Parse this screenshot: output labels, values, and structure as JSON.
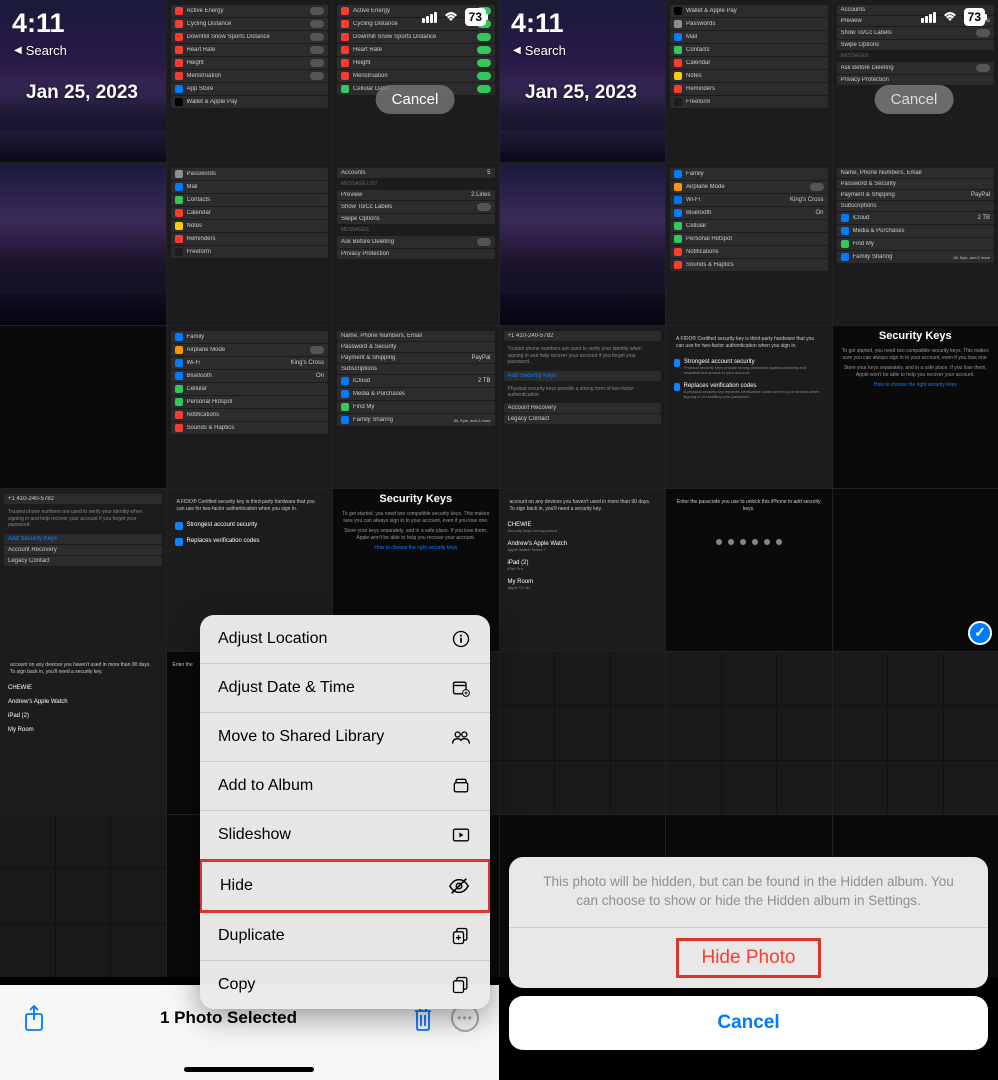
{
  "status": {
    "time": "4:11",
    "back": "Search",
    "battery": "73"
  },
  "date": "Jan 25, 2023",
  "cancel_pill": "Cancel",
  "context_menu": {
    "items": [
      {
        "label": "Adjust Location",
        "icon": "info-icon"
      },
      {
        "label": "Adjust Date & Time",
        "icon": "calendar-plus-icon"
      },
      {
        "label": "Move to Shared Library",
        "icon": "people-icon"
      },
      {
        "label": "Add to Album",
        "icon": "album-icon"
      },
      {
        "label": "Slideshow",
        "icon": "play-rect-icon"
      },
      {
        "label": "Hide",
        "icon": "eye-slash-icon",
        "highlighted": true
      },
      {
        "label": "Duplicate",
        "icon": "duplicate-icon"
      },
      {
        "label": "Copy",
        "icon": "copy-icon"
      }
    ]
  },
  "bottom_bar": {
    "selected": "1 Photo Selected"
  },
  "action_sheet": {
    "message": "This photo will be hidden, but can be found in the Hidden album. You can choose to show or hide the Hidden album in Settings.",
    "action": "Hide Photo",
    "cancel": "Cancel"
  },
  "tiles": {
    "security_keys_title": "Security Keys",
    "security_keys_text1": "To get started, you need two compatible security keys. This makes sure you can always sign in to your account, even if you lose one.",
    "security_keys_text2": "Store your keys separately, and in a safe place. If you lose them, Apple won't be able to help you recover your account.",
    "security_keys_link": "How to choose the right security keys",
    "passcode_prompt": "Enter the passcode you use to unlock this iPhone to add security keys.",
    "signin_prompt": "account on any devices you haven't used in more than 90 days. To sign back in, you'll need a security key.",
    "devices": [
      "CHEWIE",
      "Andrew's Apple Watch",
      "iPad (2)",
      "My Room"
    ],
    "health_rows": [
      "Active Energy",
      "Cycling Distance",
      "Downhill Snow Sports Distance",
      "Heart Rate",
      "Height",
      "Menstruation",
      "App Store",
      "Wallet & Apple Pay"
    ],
    "settings_rows": [
      "Passwords",
      "Mail",
      "Contacts",
      "Calendar",
      "Notes",
      "Reminders",
      "Freeform"
    ],
    "settings_rows2": [
      "Family",
      "Airplane Mode",
      "Wi-Fi",
      "Bluetooth",
      "Cellular",
      "Personal Hotspot",
      "Notifications",
      "Sounds & Haptics"
    ],
    "settings_rows3": [
      "Accounts",
      "Preview",
      "Show To/Cc Labels",
      "Swipe Options",
      "Ask Before Deleting",
      "Privacy Protection"
    ],
    "settings_rows4": [
      "Name, Phone Numbers, Email",
      "Password & Security",
      "Payment & Shipping",
      "Subscriptions",
      "iCloud",
      "Media & Purchases",
      "Find My",
      "Family Sharing"
    ],
    "phone_number": "+1 410-240-5782",
    "add_keys": "Add Security Keys",
    "account_recovery": "Account Recovery",
    "legacy_contact": "Legacy Contact",
    "strong_security": "Strongest account security",
    "replaces_codes": "Replaces verification codes",
    "wifi_network": "King's Cross",
    "bt_status": "On",
    "icloud_storage": "2 TB",
    "paypal": "PayPal",
    "family_sharing_detail": "Jill, Kyle, and 2 more",
    "preview_lines": "2 Lines",
    "accounts_count": "5",
    "messages_header": "MESSAGES",
    "message_list_header": "MESSAGE LIST",
    "cellular_data": "Cellular Data",
    "fido_text": "A FIDO® Certified security key is third-party hardware that you can use for two-factor authentication when you sign in."
  }
}
